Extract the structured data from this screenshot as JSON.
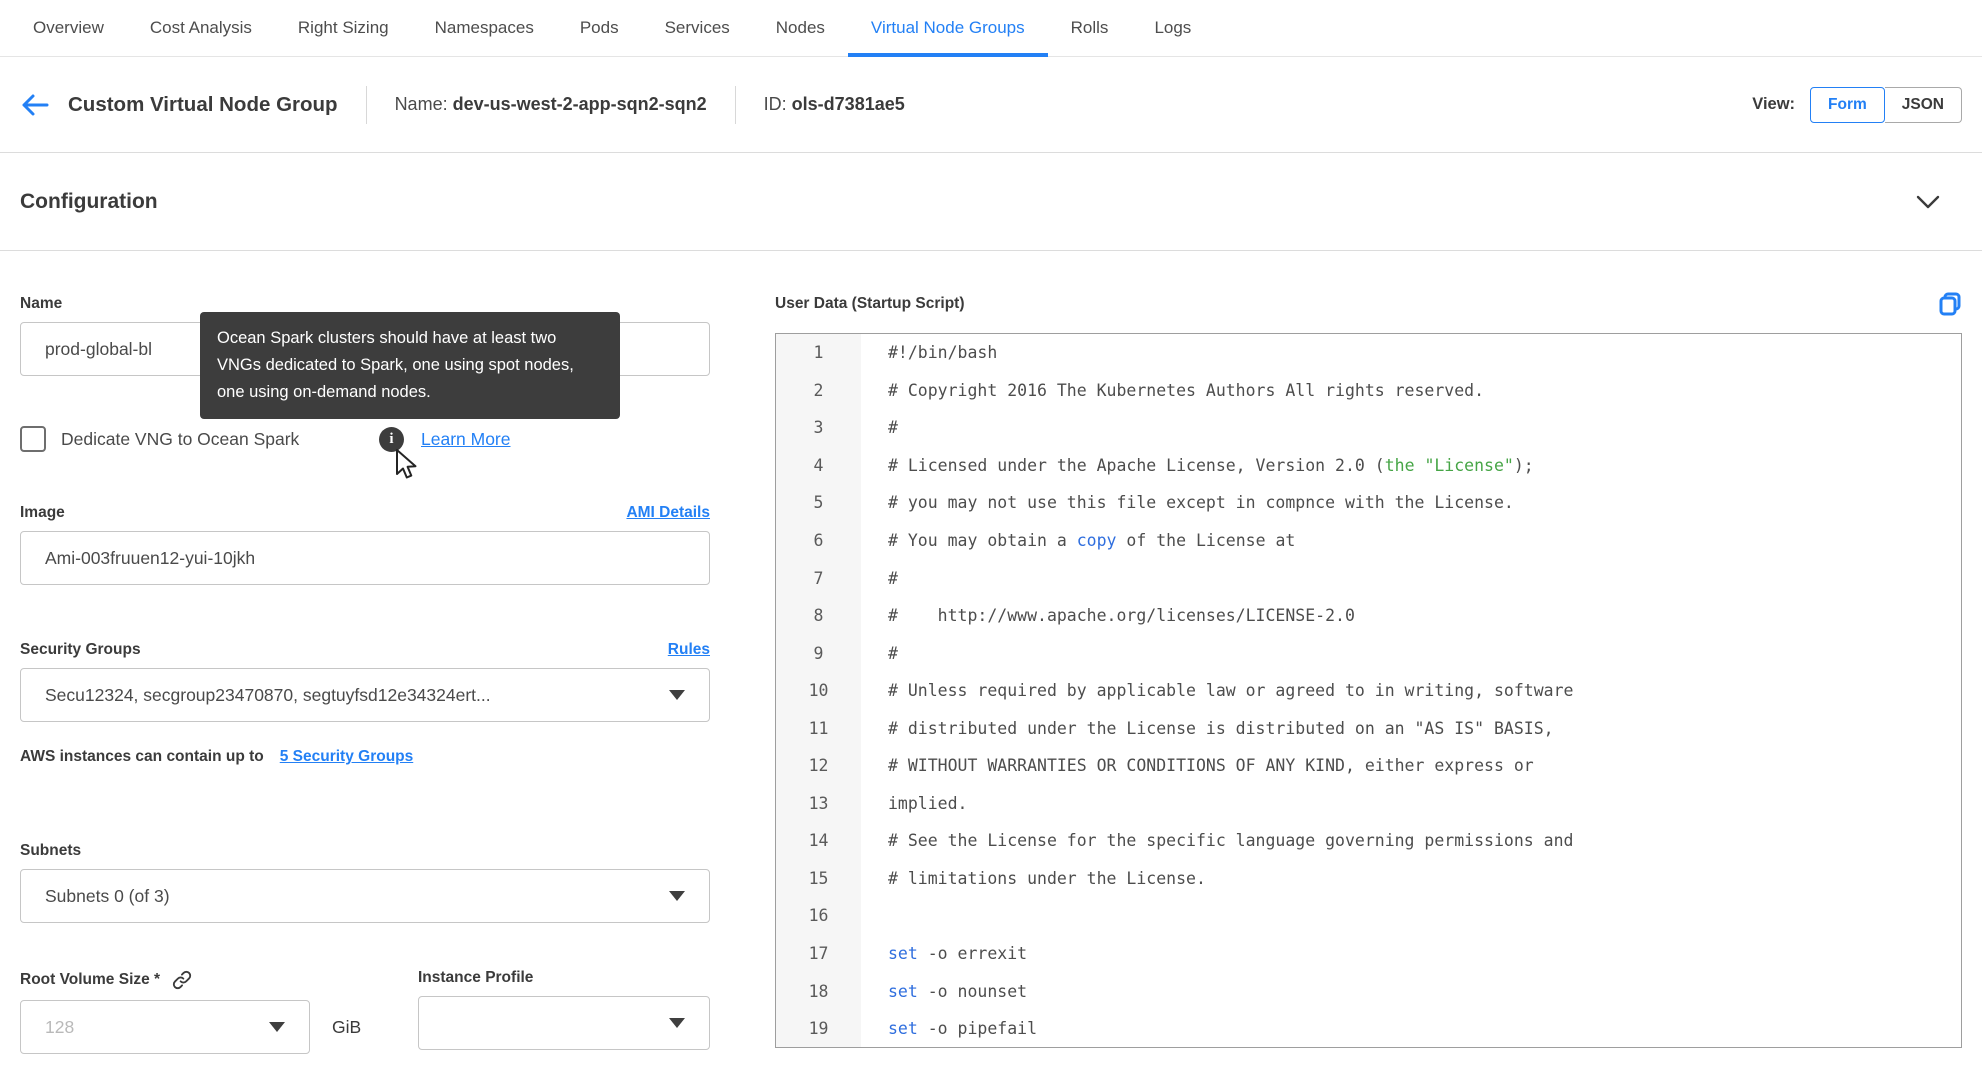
{
  "colors": {
    "accent": "#2380f5",
    "code_green": "#46a546",
    "code_blue": "#2f6ede",
    "tooltip_bg": "#3d3d3d"
  },
  "icons": [
    "back-arrow-icon",
    "chevron-down-icon",
    "info-icon",
    "mouse-cursor-icon",
    "link-icon",
    "copy-icon",
    "dropdown-caret-icon"
  ],
  "nav": {
    "tabs": [
      {
        "label": "Overview",
        "active": false
      },
      {
        "label": "Cost Analysis",
        "active": false
      },
      {
        "label": "Right Sizing",
        "active": false
      },
      {
        "label": "Namespaces",
        "active": false
      },
      {
        "label": "Pods",
        "active": false
      },
      {
        "label": "Services",
        "active": false
      },
      {
        "label": "Nodes",
        "active": false
      },
      {
        "label": "Virtual Node Groups",
        "active": true
      },
      {
        "label": "Rolls",
        "active": false
      },
      {
        "label": "Logs",
        "active": false
      }
    ]
  },
  "header": {
    "title": "Custom Virtual Node Group",
    "name_label": "Name:",
    "name_value": "dev-us-west-2-app-sqn2-sqn2",
    "id_label": "ID:",
    "id_value": "ols-d7381ae5",
    "view_label": "View:",
    "view_options": [
      {
        "label": "Form",
        "selected": true
      },
      {
        "label": "JSON",
        "selected": false
      }
    ]
  },
  "section": {
    "title": "Configuration"
  },
  "form": {
    "name": {
      "label": "Name",
      "value": "prod-global-bl"
    },
    "tooltip_text": "Ocean Spark clusters should have at least two VNGs dedicated to Spark, one using spot nodes, one using on-demand nodes.",
    "dedicate": {
      "label": "Dedicate VNG to Ocean Spark",
      "checked": false,
      "learn_more": "Learn More"
    },
    "image": {
      "label": "Image",
      "link": "AMI Details",
      "value": "Ami-003fruuen12-yui-10jkh"
    },
    "security_groups": {
      "label": "Security Groups",
      "link": "Rules",
      "value": "Secu12324, secgroup23470870, segtuyfsd12e34324ert...",
      "helper_text": "AWS instances can contain up to",
      "helper_link": "5 Security Groups"
    },
    "subnets": {
      "label": "Subnets",
      "value": "Subnets 0 (of 3)"
    },
    "root_volume": {
      "label": "Root Volume Size *",
      "placeholder": "128",
      "unit": "GiB"
    },
    "instance_profile": {
      "label": "Instance Profile",
      "value": ""
    }
  },
  "editor": {
    "title": "User Data (Startup Script)",
    "lines": [
      [
        [
          "#!/bin/bash",
          "d"
        ]
      ],
      [
        [
          "# Copyright 2016 The Kubernetes Authors All rights reserved.",
          "d"
        ]
      ],
      [
        [
          "#",
          "d"
        ]
      ],
      [
        [
          "# Licensed under the Apache License, Version 2.0 (",
          "d"
        ],
        [
          "the \"License\"",
          "g"
        ],
        [
          ");",
          "d"
        ]
      ],
      [
        [
          "# you may not use this file except in compnce with the License.",
          "d"
        ]
      ],
      [
        [
          "# You may obtain a ",
          "d"
        ],
        [
          "copy",
          "b"
        ],
        [
          " of the License at",
          "d"
        ]
      ],
      [
        [
          "#",
          "d"
        ]
      ],
      [
        [
          "#    http://www.apache.org/licenses/LICENSE-2.0",
          "d"
        ]
      ],
      [
        [
          "#",
          "d"
        ]
      ],
      [
        [
          "# Unless required by applicable law or agreed to in writing, software",
          "d"
        ]
      ],
      [
        [
          "# distributed under the License is distributed on an \"AS IS\" BASIS,",
          "d"
        ]
      ],
      [
        [
          "# WITHOUT WARRANTIES OR CONDITIONS OF ANY KIND, either express or",
          "d"
        ]
      ],
      [
        [
          "implied.",
          "d"
        ]
      ],
      [
        [
          "# See the License for the specific language governing permissions and",
          "d"
        ]
      ],
      [
        [
          "# limitations under the License.",
          "d"
        ]
      ],
      [],
      [
        [
          "set",
          "b"
        ],
        [
          " -o errexit",
          "d"
        ]
      ],
      [
        [
          "set",
          "b"
        ],
        [
          " -o nounset",
          "d"
        ]
      ],
      [
        [
          "set",
          "b"
        ],
        [
          " -o pipefail",
          "d"
        ]
      ]
    ]
  }
}
